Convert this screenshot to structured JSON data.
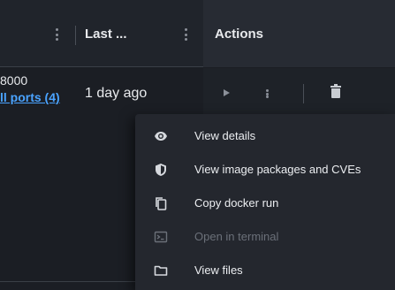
{
  "table": {
    "columns": [
      {
        "label": ""
      },
      {
        "label": "Last ..."
      },
      {
        "label": "Actions"
      }
    ],
    "row": {
      "ports_text": "8000",
      "ports_link": "ll ports (4)",
      "last": "1 day ago"
    }
  },
  "menu": {
    "items": [
      {
        "label": "View details",
        "icon": "eye-icon",
        "enabled": true
      },
      {
        "label": "View image packages and CVEs",
        "icon": "shield-icon",
        "enabled": true
      },
      {
        "label": "Copy docker run",
        "icon": "copy-icon",
        "enabled": true
      },
      {
        "label": "Open in terminal",
        "icon": "terminal-icon",
        "enabled": false
      },
      {
        "label": "View files",
        "icon": "folder-icon",
        "enabled": true
      }
    ]
  },
  "colors": {
    "background": "#1b1e24",
    "header": "#20242b",
    "menu": "#24272e",
    "link": "#4aa3ff",
    "disabled_text": "#6b7079"
  }
}
